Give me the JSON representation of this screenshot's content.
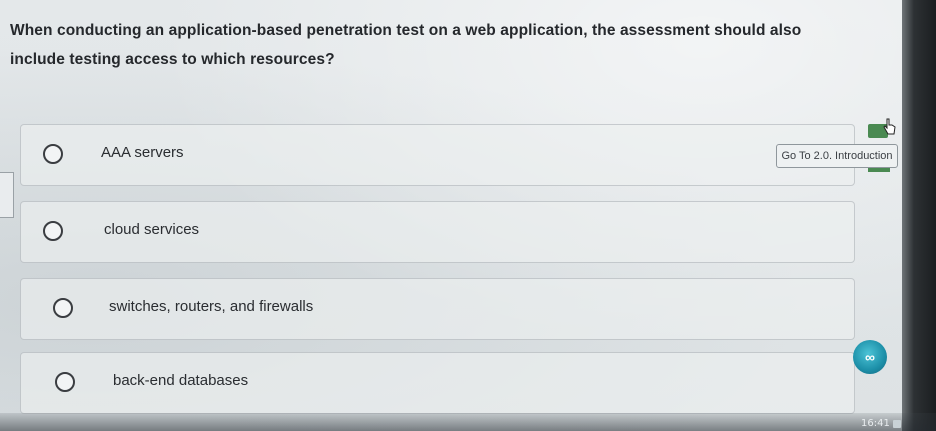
{
  "question": {
    "text": "When conducting an application-based penetration test on a web application, the assessment should also include testing access to which resources?"
  },
  "options": [
    {
      "label": "AAA servers"
    },
    {
      "label": "cloud services"
    },
    {
      "label": "switches, routers, and firewalls"
    },
    {
      "label": "back-end databases"
    }
  ],
  "goto_button": {
    "label": "Go To 2.0. Introduction"
  },
  "app_icon": {
    "glyph": "∞",
    "color": "#1c8fa8"
  },
  "taskbar": {
    "time": "16:41"
  },
  "colors": {
    "accent_green": "#4a8a52",
    "bezel": "#1b1e20"
  }
}
